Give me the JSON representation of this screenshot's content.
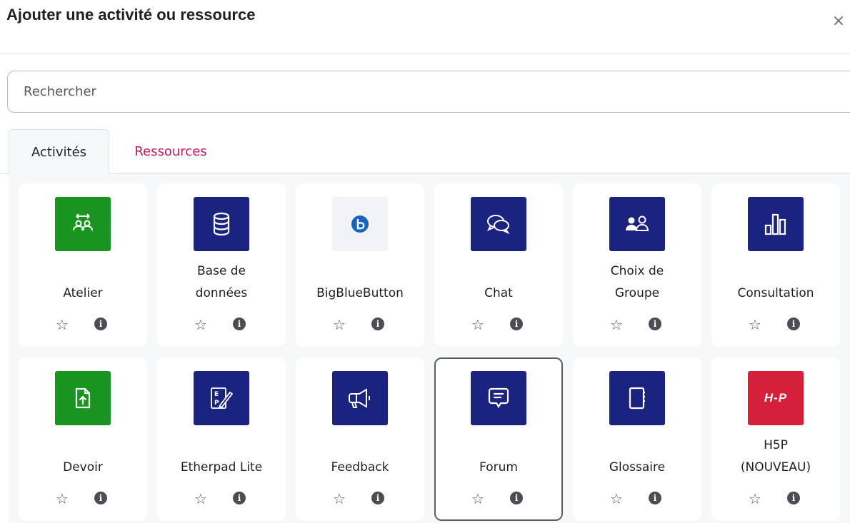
{
  "modal": {
    "title": "Ajouter une activité ou ressource",
    "close_label": "×"
  },
  "search": {
    "placeholder": "Rechercher",
    "value": ""
  },
  "tabs": [
    {
      "label": "Activités",
      "active": true
    },
    {
      "label": "Ressources",
      "active": false
    }
  ],
  "colors": {
    "green": "#18941f",
    "blue": "#1a237e",
    "red": "#d5203a",
    "bbb_bg": "#f1f3f6",
    "bbb_badge": "#1565c0",
    "tab_inactive": "#c2185b"
  },
  "activities": [
    {
      "name": "Atelier",
      "icon": "workshop-icon",
      "color": "green"
    },
    {
      "name": "Base de données",
      "icon": "database-icon",
      "color": "blue"
    },
    {
      "name": "BigBlueButton",
      "icon": "bigbluebutton-icon",
      "color": "bbb_bg"
    },
    {
      "name": "Chat",
      "icon": "chat-icon",
      "color": "blue"
    },
    {
      "name": "Choix de Groupe",
      "icon": "group-choice-icon",
      "color": "blue"
    },
    {
      "name": "Consultation",
      "icon": "survey-chart-icon",
      "color": "blue"
    },
    {
      "name": "Devoir",
      "icon": "assignment-upload-icon",
      "color": "green"
    },
    {
      "name": "Etherpad Lite",
      "icon": "etherpad-icon",
      "color": "blue"
    },
    {
      "name": "Feedback",
      "icon": "megaphone-icon",
      "color": "blue"
    },
    {
      "name": "Forum",
      "icon": "forum-icon",
      "color": "blue",
      "selected": true
    },
    {
      "name": "Glossaire",
      "icon": "glossary-book-icon",
      "color": "blue"
    },
    {
      "name": "H5P (NOUVEAU)",
      "icon": "h5p-icon",
      "color": "red",
      "badge_text": "H-P"
    }
  ],
  "card_actions": {
    "star_glyph": "☆",
    "info_glyph": "i"
  }
}
